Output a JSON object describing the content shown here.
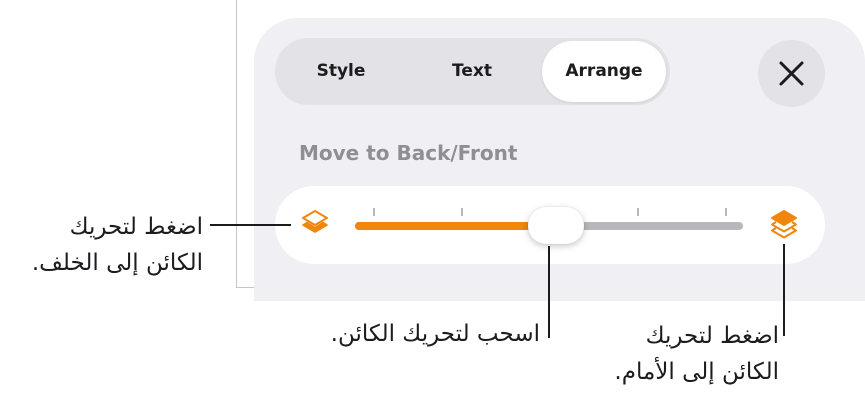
{
  "tabs": [
    {
      "label": "Style",
      "selected": false
    },
    {
      "label": "Text",
      "selected": false
    },
    {
      "label": "Arrange",
      "selected": true
    }
  ],
  "close_icon": "close-icon",
  "section": {
    "title": "Move to Back/Front"
  },
  "slider": {
    "value_fraction": 0.45,
    "ticks": 5,
    "back_icon": "layers-back-icon",
    "front_icon": "layers-front-icon",
    "accent_color": "#f0860c"
  },
  "callouts": {
    "back": {
      "line1": "اضغط لتحريك",
      "line2": "الكائن إلى الخلف."
    },
    "drag": {
      "line1": "اسحب لتحريك الكائن."
    },
    "front": {
      "line1": "اضغط لتحريك",
      "line2": "الكائن إلى الأمام."
    }
  }
}
